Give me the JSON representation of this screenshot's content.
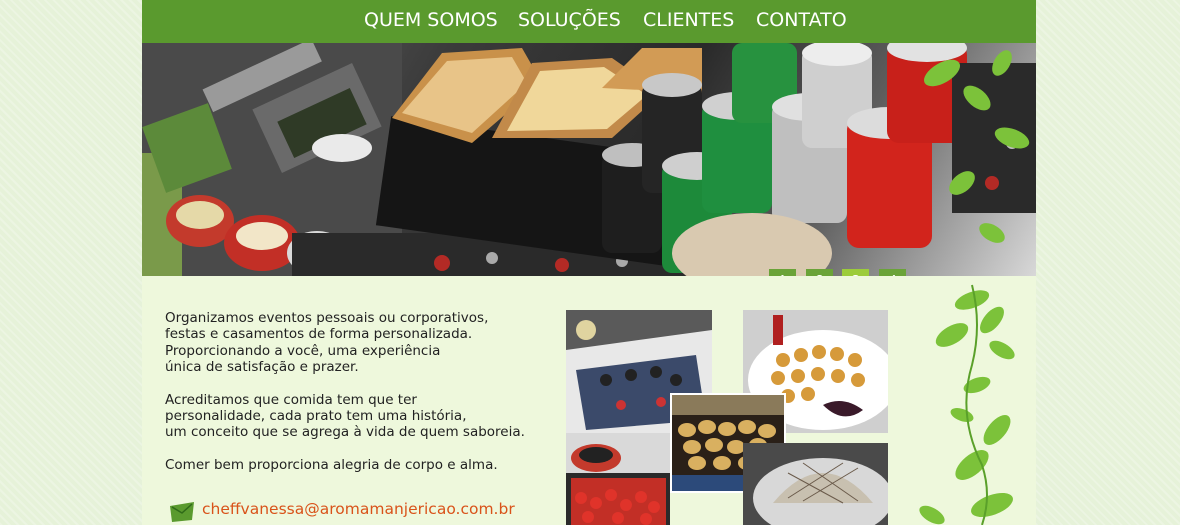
{
  "nav": {
    "items": [
      {
        "label": "QUEM SOMOS"
      },
      {
        "label": "SOLUÇÕES"
      },
      {
        "label": "CLIENTES"
      },
      {
        "label": "CONTATO"
      }
    ]
  },
  "slider": {
    "buttons": [
      "1",
      "2",
      "3",
      "4"
    ],
    "active": "3"
  },
  "content": {
    "paragraph1": "Organizamos eventos pessoais ou corporativos,\nfestas e casamentos de forma personalizada.\nProporcionando a você, uma experiência\núnica de satisfação e prazer.",
    "paragraph2": "Acreditamos que comida tem que ter\npersonalidade, cada prato tem uma história,\num conceito que se agrega à vida de quem saboreia.",
    "paragraph3": "Comer bem proporciona alegria de corpo e alma.",
    "email": "cheffvanessa@aromamanjericao.com.br"
  },
  "colors": {
    "nav_bg": "#5a9a2e",
    "slide_btn": "#6aa338",
    "slide_btn_active": "#9ccc3a",
    "email": "#d9531a",
    "leaf": "#7cc23a"
  },
  "icons": {
    "email": "mail-envelope-icon",
    "decoration": "leaf-vine-icon"
  }
}
